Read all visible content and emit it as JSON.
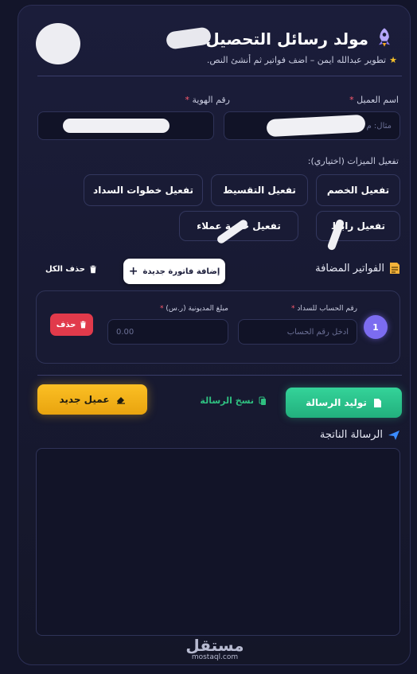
{
  "header": {
    "title": "مولد رسائل التحصيل –",
    "subtitle": "تطوير عبدالله ايمن – اضف فواتير ثم أنشئ النص.",
    "icon": "rocket-icon",
    "star_icon": "star-icon"
  },
  "client": {
    "name_label": "اسم العميل",
    "name_placeholder": "مثال: م",
    "id_label": "رقم الهوية",
    "id_placeholder": "",
    "required_mark": "*"
  },
  "features": {
    "label": "تفعيل الميزات (اختياري):",
    "buttons": [
      "تفعيل الخصم",
      "تفعيل التقسيط",
      "تفعيل خطوات السداد",
      "تفعيل رابط",
      "تفعيل خدمة عملاء"
    ]
  },
  "invoices": {
    "title": "الفواتير المضافة",
    "add_button": "إضافة فاتورة جديدة",
    "delete_all": "حذف الكل",
    "items": [
      {
        "number": "1",
        "account_label": "رقم الحساب للسداد",
        "account_placeholder": "أدخل رقم الحساب",
        "amount_label": "مبلغ المديونية (ر.س)",
        "amount_placeholder": "0.00",
        "delete_label": "حذف"
      }
    ]
  },
  "actions": {
    "generate": "توليد الرسالة",
    "copy": "نسخ الرسالة",
    "new_client": "عميل جديد"
  },
  "result": {
    "title": "الرسالة الناتجة"
  },
  "watermark": {
    "brand": "مستقل",
    "domain": "mostaql.com"
  },
  "colors": {
    "background": "#13152a",
    "accent_purple": "#7c6cf0",
    "green": "#34d399",
    "yellow": "#fbbf24",
    "red": "#e13a4b",
    "required": "#ff5b6e"
  }
}
